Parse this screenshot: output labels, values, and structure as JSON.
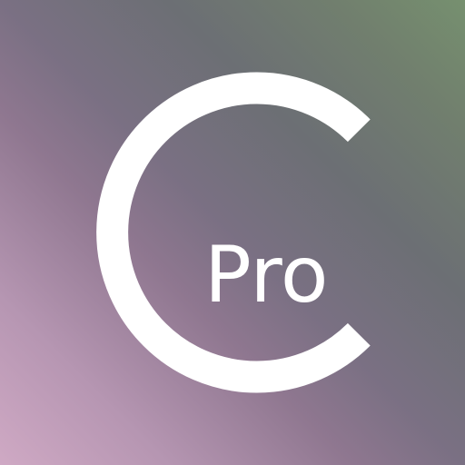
{
  "icon": {
    "wordmark": "Pro",
    "logo_color": "#ffffff",
    "gradient_colors": [
      "#cfa9c4",
      "#7a7083",
      "#76906f"
    ]
  }
}
